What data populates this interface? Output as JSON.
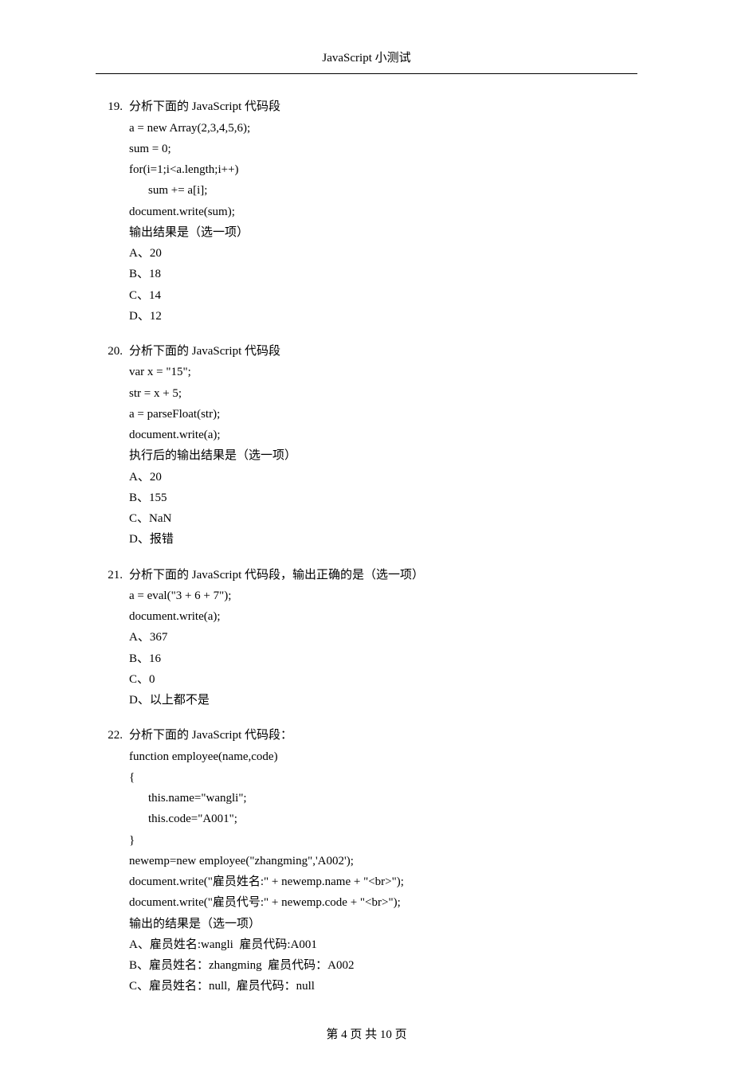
{
  "header": "JavaScript 小测试",
  "questions": [
    {
      "num": "19.",
      "lines": [
        {
          "t": "分析下面的 JavaScript 代码段"
        },
        {
          "t": "a = new Array(2,3,4,5,6);"
        },
        {
          "t": "sum = 0;"
        },
        {
          "t": "for(i=1;i<a.length;i++)"
        },
        {
          "t": "sum += a[i];",
          "cls": "indent1"
        },
        {
          "t": "document.write(sum);"
        },
        {
          "t": "输出结果是（选一项）"
        },
        {
          "t": "A、20"
        },
        {
          "t": "B、18"
        },
        {
          "t": "C、14"
        },
        {
          "t": "D、12"
        }
      ]
    },
    {
      "num": "20.",
      "lines": [
        {
          "t": "分析下面的 JavaScript 代码段"
        },
        {
          "t": "var x = \"15\";"
        },
        {
          "t": "str = x + 5;"
        },
        {
          "t": "a = parseFloat(str);"
        },
        {
          "t": "document.write(a);"
        },
        {
          "t": "执行后的输出结果是（选一项）"
        },
        {
          "t": "A、20"
        },
        {
          "t": "B、155"
        },
        {
          "t": "C、NaN"
        },
        {
          "t": "D、报错"
        }
      ]
    },
    {
      "num": "21.",
      "lines": [
        {
          "t": "分析下面的 JavaScript 代码段，输出正确的是（选一项）"
        },
        {
          "t": "a = eval(\"3 + 6 + 7\");"
        },
        {
          "t": "document.write(a);"
        },
        {
          "t": "A、367"
        },
        {
          "t": "B、16"
        },
        {
          "t": "C、0"
        },
        {
          "t": "D、以上都不是"
        }
      ]
    },
    {
      "num": "22.",
      "lines": [
        {
          "t": "分析下面的 JavaScript 代码段："
        },
        {
          "t": "function employee(name,code)"
        },
        {
          "t": "{"
        },
        {
          "t": "this.name=\"wangli\";",
          "cls": "indent1"
        },
        {
          "t": "this.code=\"A001\";",
          "cls": "indent1"
        },
        {
          "t": "}"
        },
        {
          "t": "newemp=new employee(\"zhangming\",'A002');"
        },
        {
          "t": "document.write(\"雇员姓名:\" + newemp.name + \"<br>\");"
        },
        {
          "t": "document.write(\"雇员代号:\" + newemp.code + \"<br>\");"
        },
        {
          "t": "输出的结果是（选一项）"
        },
        {
          "t": "A、雇员姓名:wangli  雇员代码:A001"
        },
        {
          "t": "B、雇员姓名：zhangming  雇员代码：A002"
        },
        {
          "t": "C、雇员姓名：null,  雇员代码：null"
        }
      ]
    }
  ],
  "footer": "第 4 页 共 10 页"
}
